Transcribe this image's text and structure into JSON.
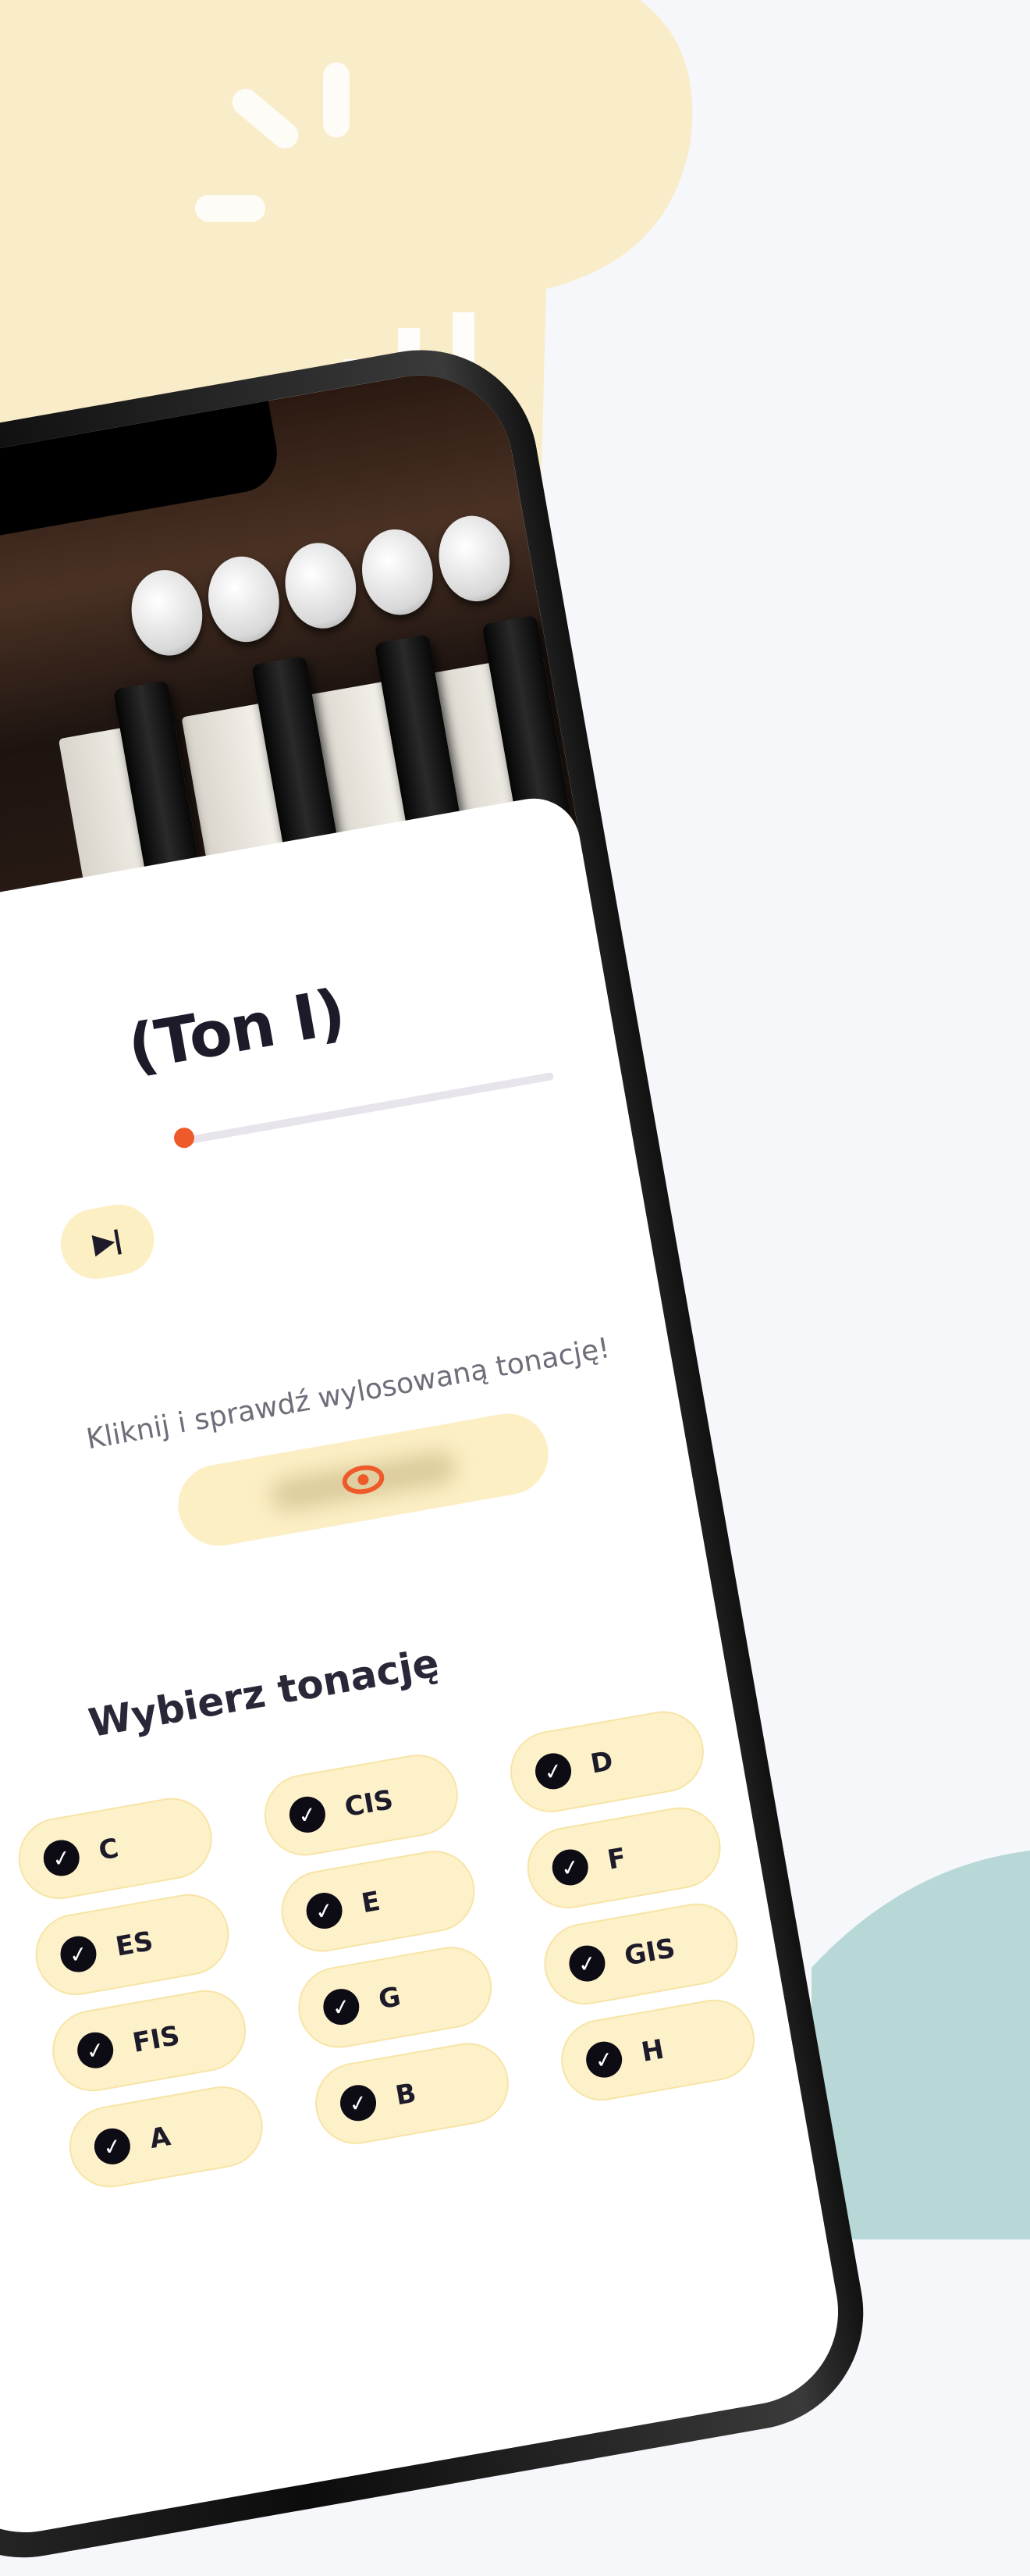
{
  "screen": {
    "title": "(Ton I)",
    "skip_icon_glyph": "▶|",
    "progress_fraction": 0.0,
    "reveal_hint": "Kliknij i sprawdź wylosowaną tonację!",
    "reveal_icon": "eye-icon",
    "section_title": "Wybierz tonację",
    "keys": [
      {
        "label": "C"
      },
      {
        "label": "CIS"
      },
      {
        "label": "D"
      },
      {
        "label": "ES"
      },
      {
        "label": "E"
      },
      {
        "label": "F"
      },
      {
        "label": "FIS"
      },
      {
        "label": "G"
      },
      {
        "label": "GIS"
      },
      {
        "label": "A"
      },
      {
        "label": "B"
      },
      {
        "label": "H"
      }
    ]
  },
  "colors": {
    "background": "#f6f7fb",
    "accent_orange": "#ee5a2a",
    "chip_fill": "#fdf1c9",
    "teal_blob": "#b7d8d6",
    "cream_blob": "#f9ecc8"
  }
}
